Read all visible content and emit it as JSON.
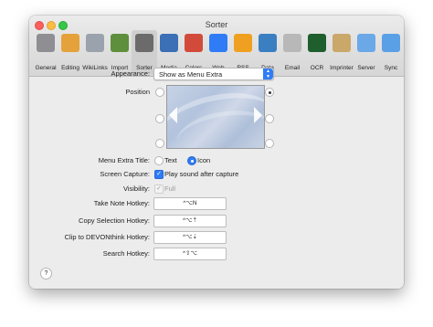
{
  "window": {
    "title": "Sorter"
  },
  "toolbar": {
    "items": [
      {
        "label": "General",
        "icon": "general-switch-icon",
        "color": "#8e8e93"
      },
      {
        "label": "Editing",
        "icon": "pencils-icon",
        "color": "#e5a23a"
      },
      {
        "label": "WikiLinks",
        "icon": "wikilinks-icon",
        "color": "#9aa3ad"
      },
      {
        "label": "Import",
        "icon": "import-tray-icon",
        "color": "#5e8f3c"
      },
      {
        "label": "Sorter",
        "icon": "sorter-icon",
        "color": "#6b6b6b"
      },
      {
        "label": "Media",
        "icon": "media-film-icon",
        "color": "#3b6fb6"
      },
      {
        "label": "Colors",
        "icon": "colors-pencils-icon",
        "color": "#d24b3a"
      },
      {
        "label": "Web",
        "icon": "globe-icon",
        "color": "#2f7cf6"
      },
      {
        "label": "RSS",
        "icon": "rss-icon",
        "color": "#f0a020"
      },
      {
        "label": "Data",
        "icon": "data-table-icon",
        "color": "#3a7fc1"
      },
      {
        "label": "Email",
        "icon": "envelope-icon",
        "color": "#b8b8b8"
      },
      {
        "label": "OCR",
        "icon": "ocr-a-icon",
        "color": "#1f5e2d"
      },
      {
        "label": "Imprinter",
        "icon": "imprinter-stamp-icon",
        "color": "#c9a86a"
      },
      {
        "label": "Server",
        "icon": "server-radar-icon",
        "color": "#6aa8e8"
      },
      {
        "label": "Sync",
        "icon": "sync-cloud-icon",
        "color": "#5aa0e6"
      }
    ],
    "selected": "Sorter"
  },
  "appearance": {
    "label": "Appearance:",
    "value": "Show as Menu Extra"
  },
  "position": {
    "label": "Position",
    "selected": "top-right"
  },
  "menu_extra_title": {
    "label": "Menu Extra Title:",
    "options": [
      "Text",
      "Icon"
    ],
    "selected": "Icon"
  },
  "screen_capture": {
    "label": "Screen Capture:",
    "option": "Play sound after capture",
    "checked": true
  },
  "visibility": {
    "label": "Visibility:",
    "option": "Full",
    "checked": true,
    "disabled": true
  },
  "hotkeys": [
    {
      "label": "Take Note Hotkey:",
      "value": "^⌥N"
    },
    {
      "label": "Copy Selection Hotkey:",
      "value": "^⌥⇡"
    },
    {
      "label": "Clip to DEVONthink Hotkey:",
      "value": "^⌥⇣"
    },
    {
      "label": "Search Hotkey:",
      "value": "^⇧⌥"
    }
  ],
  "help": {
    "label": "?"
  }
}
